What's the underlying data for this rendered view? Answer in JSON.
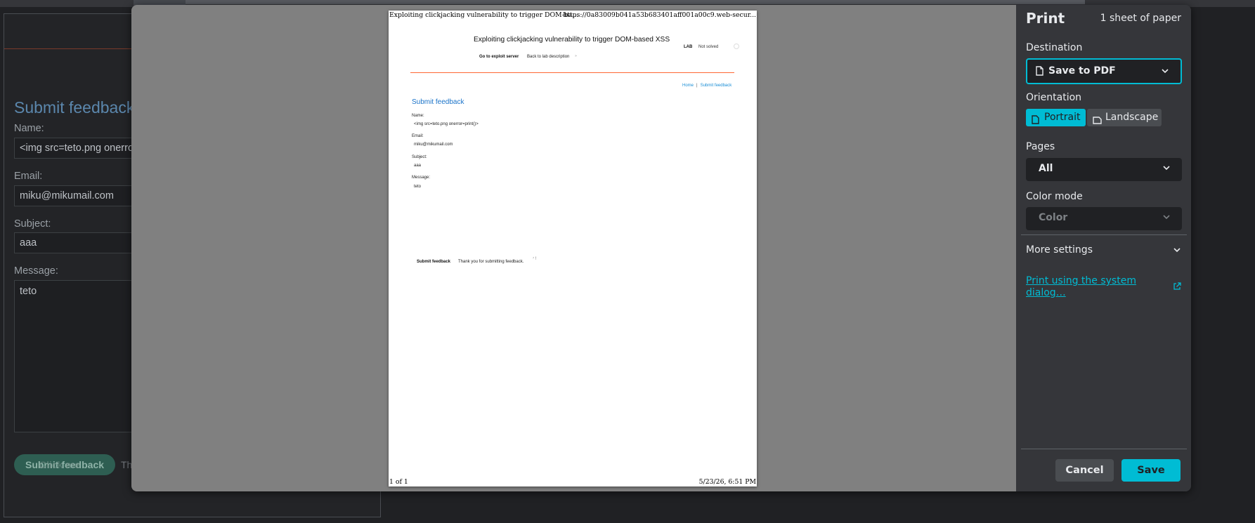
{
  "background_page": {
    "title": "Submit feedback",
    "name_label": "Name:",
    "name_value": "<img src=teto.png onerror=print()>",
    "email_label": "Email:",
    "email_value": "miku@mikumail.com",
    "subject_label": "Subject:",
    "subject_value": "aaa",
    "message_label": "Message:",
    "message_value": "teto",
    "submit_label": "Submit feedback",
    "ghost_label": "Click me",
    "thanks_text": "Tha"
  },
  "preview": {
    "header_left": "Exploiting clickjacking vulnerability to trigger DOM-ba...",
    "header_right": "https://0a83009b041a53b683401aff001a00c9.web-secur...",
    "footer_left": "1 of 1",
    "footer_right": "5/23/26, 6:51 PM",
    "lab_title": "Exploiting clickjacking vulnerability to trigger DOM-based XSS",
    "lab_badge": "LAB",
    "lab_status": "Not solved",
    "exploit_link": "Go to exploit server",
    "back_link": "Back to lab description",
    "back_arrow": "»",
    "nav_home": "Home",
    "nav_sep": "|",
    "nav_feedback": "Submit feedback",
    "heading": "Submit feedback",
    "name_label": "Name:",
    "name_value": "<img src=teto.png onerror=print()>",
    "email_label": "Email:",
    "email_value": "miku@mikumail.com",
    "subject_label": "Subject:",
    "subject_value": "aaa",
    "message_label": "Message:",
    "message_value": "teto",
    "submit_label": "Submit feedback",
    "thanks_text": "Thank you for submitting feedback.",
    "ghost_text": "⁷ !"
  },
  "settings": {
    "title": "Print",
    "sheet_count": "1 sheet of paper",
    "destination_label": "Destination",
    "destination_value": "Save to PDF",
    "orientation_label": "Orientation",
    "portrait_label": "Portrait",
    "landscape_label": "Landscape",
    "orientation_selected": "Portrait",
    "pages_label": "Pages",
    "pages_value": "All",
    "color_mode_label": "Color mode",
    "color_mode_value": "Color",
    "more_settings_label": "More settings",
    "system_dialog_link": "Print using the system dialog…",
    "cancel_label": "Cancel",
    "save_label": "Save"
  },
  "colors": {
    "accent": "#00bcd4",
    "dialog_bg": "#35363a",
    "preview_bg": "#808080",
    "lab_rule": "#ff6633",
    "lab_link": "#1a8ed6"
  },
  "icons": [
    "document-icon",
    "chevron-down-icon",
    "external-link-icon"
  ]
}
